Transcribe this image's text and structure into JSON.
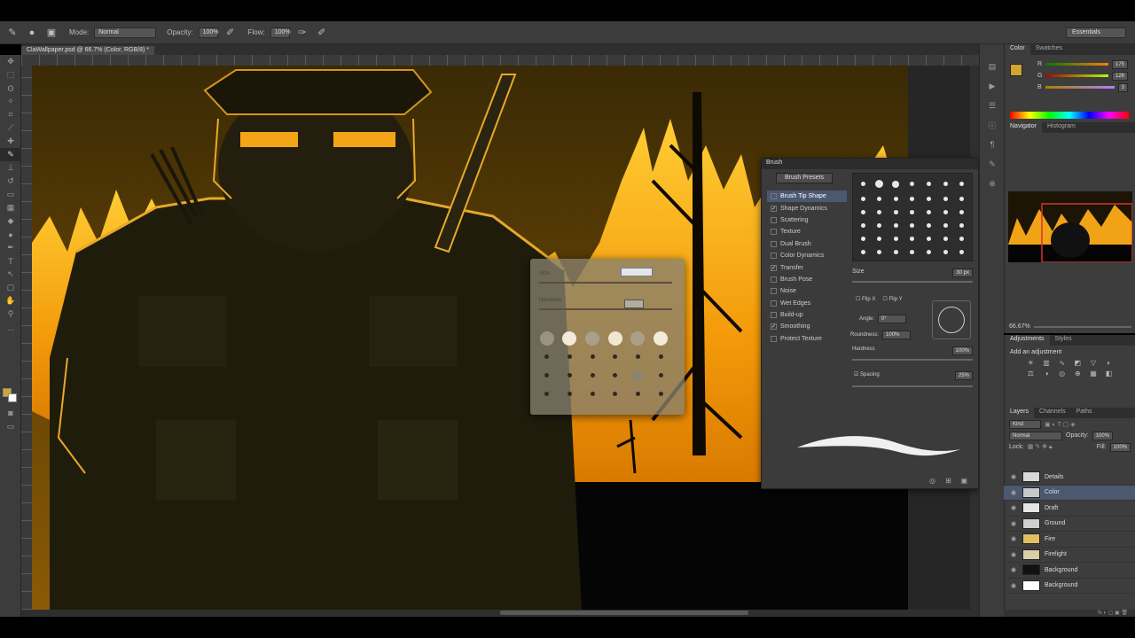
{
  "document": {
    "tab_label": "ClaWallpaper.psd @ 66.7% (Color, RGB/8) *"
  },
  "options_bar": {
    "mode_label": "Mode:",
    "mode_value": "Normal",
    "opacity_label": "Opacity:",
    "opacity_value": "100%",
    "flow_label": "Flow:",
    "flow_value": "100%",
    "workspace": "Essentials"
  },
  "color_panel": {
    "tabs": [
      "Color",
      "Swatches"
    ],
    "channels": [
      {
        "name": "R",
        "value": "175"
      },
      {
        "name": "G",
        "value": "126"
      },
      {
        "name": "B",
        "value": "3"
      }
    ],
    "foreground_color": "#d2a431"
  },
  "navigator_panel": {
    "tabs": [
      "Navigator",
      "Histogram"
    ],
    "zoom": "66.67%"
  },
  "adjustments_panel": {
    "tabs": [
      "Adjustments",
      "Styles"
    ],
    "title": "Add an adjustment"
  },
  "layers_panel": {
    "tabs": [
      "Layers",
      "Channels",
      "Paths"
    ],
    "filter_value": "Kind",
    "blend_mode": "Normal",
    "opacity_label": "Opacity:",
    "opacity_value": "100%",
    "lock_label": "Lock:",
    "fill_label": "Fill:",
    "fill_value": "100%",
    "layers": [
      {
        "name": "Details",
        "thumb": "#d8d8d8",
        "selected": false
      },
      {
        "name": "Color",
        "thumb": "#c9c9c9",
        "selected": true
      },
      {
        "name": "Draft",
        "thumb": "#e5e5e5",
        "selected": false
      },
      {
        "name": "Ground",
        "thumb": "#cfcfcf",
        "selected": false
      },
      {
        "name": "Fire",
        "thumb": "#e0c060",
        "selected": false
      },
      {
        "name": "Firelight",
        "thumb": "#d8cfa8",
        "selected": false
      },
      {
        "name": "Background",
        "thumb": "#111111",
        "selected": false
      },
      {
        "name": "Background",
        "thumb": "#ffffff",
        "selected": false
      }
    ]
  },
  "brush_panel": {
    "title": "Brush",
    "presets_button": "Brush Presets",
    "options": [
      {
        "label": "Brush Tip Shape",
        "checked": false,
        "selected": true
      },
      {
        "label": "Shape Dynamics",
        "checked": true,
        "selected": false
      },
      {
        "label": "Scattering",
        "checked": false,
        "selected": false
      },
      {
        "label": "Texture",
        "checked": false,
        "selected": false
      },
      {
        "label": "Dual Brush",
        "checked": false,
        "selected": false
      },
      {
        "label": "Color Dynamics",
        "checked": false,
        "selected": false
      },
      {
        "label": "Transfer",
        "checked": true,
        "selected": false
      },
      {
        "label": "Brush Pose",
        "checked": false,
        "selected": false
      },
      {
        "label": "Noise",
        "checked": false,
        "selected": false
      },
      {
        "label": "Wet Edges",
        "checked": false,
        "selected": false
      },
      {
        "label": "Build-up",
        "checked": false,
        "selected": false
      },
      {
        "label": "Smoothing",
        "checked": true,
        "selected": false
      },
      {
        "label": "Protect Texture",
        "checked": false,
        "selected": false
      }
    ],
    "size_label": "Size",
    "size_value": "30 px",
    "flip_x": "Flip X",
    "flip_y": "Flip Y",
    "angle_label": "Angle:",
    "angle_value": "0°",
    "roundness_label": "Roundness:",
    "roundness_value": "100%",
    "hardness_label": "Hardness",
    "hardness_value": "100%",
    "spacing_label": "Spacing",
    "spacing_value": "25%"
  },
  "hud": {
    "size_label": "Size",
    "hardness_label": "Hardness"
  }
}
